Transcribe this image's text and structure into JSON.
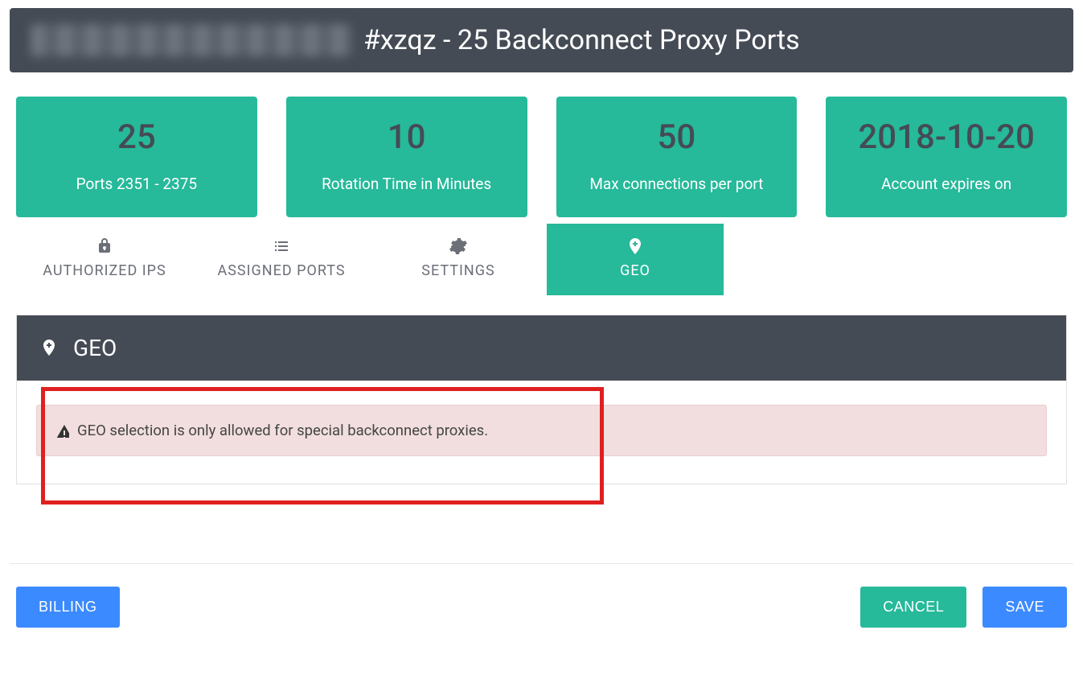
{
  "header": {
    "title": "#xzqz - 25 Backconnect Proxy Ports"
  },
  "stats": [
    {
      "value": "25",
      "label": "Ports 2351 - 2375"
    },
    {
      "value": "10",
      "label": "Rotation Time in Minutes"
    },
    {
      "value": "50",
      "label": "Max connections per port"
    },
    {
      "value": "2018-10-20",
      "label": "Account expires on"
    }
  ],
  "tabs": [
    {
      "label": "AUTHORIZED IPS",
      "icon": "lock-icon"
    },
    {
      "label": "ASSIGNED PORTS",
      "icon": "list-icon"
    },
    {
      "label": "SETTINGS",
      "icon": "gear-icon"
    },
    {
      "label": "GEO",
      "icon": "pin-plus-icon",
      "active": true
    }
  ],
  "section": {
    "title": "GEO",
    "alert": "GEO selection is only allowed for special backconnect proxies."
  },
  "footer": {
    "billing": "BILLING",
    "cancel": "CANCEL",
    "save": "SAVE"
  }
}
